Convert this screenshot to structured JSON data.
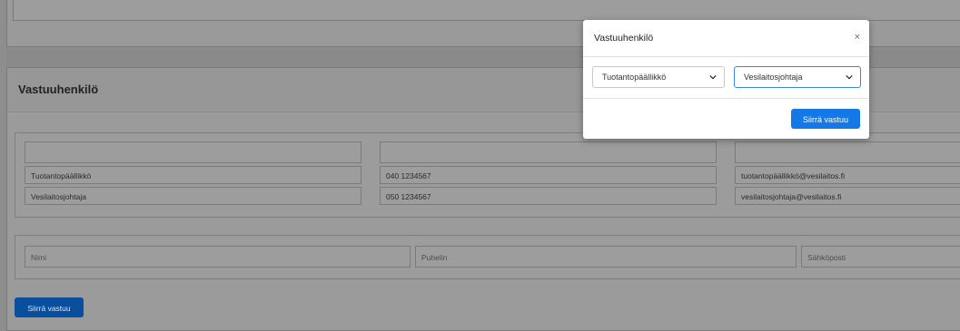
{
  "panel": {
    "title": "Vastuuhenkilö"
  },
  "contacts_table": {
    "rows": [
      {
        "name": "",
        "phone": "",
        "email": ""
      },
      {
        "name": "Tuotantopäällikkö",
        "phone": "040 1234567",
        "email": "tuotantopäällikkö@vesilaitos.fi"
      },
      {
        "name": "Vesilaitosjohtaja",
        "phone": "050 1234567",
        "email": "vesilaitosjohtaja@vesilaitos.fi"
      }
    ]
  },
  "new_contact": {
    "name_placeholder": "Nimi",
    "phone_placeholder": "Puhelin",
    "email_placeholder": "Sähköposti"
  },
  "transfer_button": "Siirrä vastuu",
  "modal": {
    "title": "Vastuuhenkilö",
    "close_icon": "×",
    "from_select": "Tuotantopäällikkö",
    "to_select": "Vesilaitosjohtaja",
    "submit_label": "Siirrä vastuu"
  },
  "colors": {
    "primary": "#1479e6",
    "overlay": "#8e8e8e"
  }
}
